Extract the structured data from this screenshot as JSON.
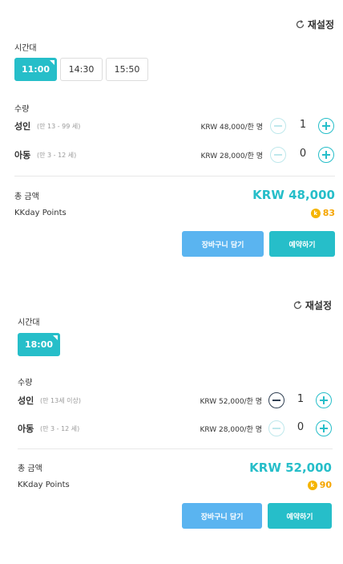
{
  "panels": [
    {
      "reset_label": "재설정",
      "time_label": "시간대",
      "time_slots": [
        "11:00",
        "14:30",
        "15:50"
      ],
      "selected_time": "11:00",
      "quantity_label": "수량",
      "rows": [
        {
          "label": "성인",
          "age": "(만 13 - 99 세)",
          "price": "KRW 48,000/한 명",
          "qty": "1"
        },
        {
          "label": "아동",
          "age": "(만 3 - 12 세)",
          "price": "KRW 28,000/한 명",
          "qty": "0"
        }
      ],
      "total_label": "총 금액",
      "total_amount": "KRW 48,000",
      "points_label": "KKday Points",
      "points_value": "83",
      "cart_label": "장바구니 담기",
      "book_label": "예약하기"
    },
    {
      "reset_label": "재설정",
      "time_label": "시간대",
      "time_slots": [
        "18:00"
      ],
      "selected_time": "18:00",
      "quantity_label": "수량",
      "rows": [
        {
          "label": "성인",
          "age": "(만 13세 이상)",
          "price": "KRW 52,000/한 명",
          "qty": "1"
        },
        {
          "label": "아동",
          "age": "(만 3 - 12 세)",
          "price": "KRW 28,000/한 명",
          "qty": "0"
        }
      ],
      "total_label": "총 금액",
      "total_amount": "KRW 52,000",
      "points_label": "KKday Points",
      "points_value": "90",
      "cart_label": "장바구니 담기",
      "book_label": "예약하기"
    }
  ],
  "colors": {
    "accent": "#26bec9",
    "cart_button": "#5ab4f0",
    "points": "#f5a500"
  },
  "icons": {
    "reset": "refresh-icon",
    "points": "kkday-coin-icon",
    "minus": "minus-icon",
    "plus": "plus-icon"
  }
}
